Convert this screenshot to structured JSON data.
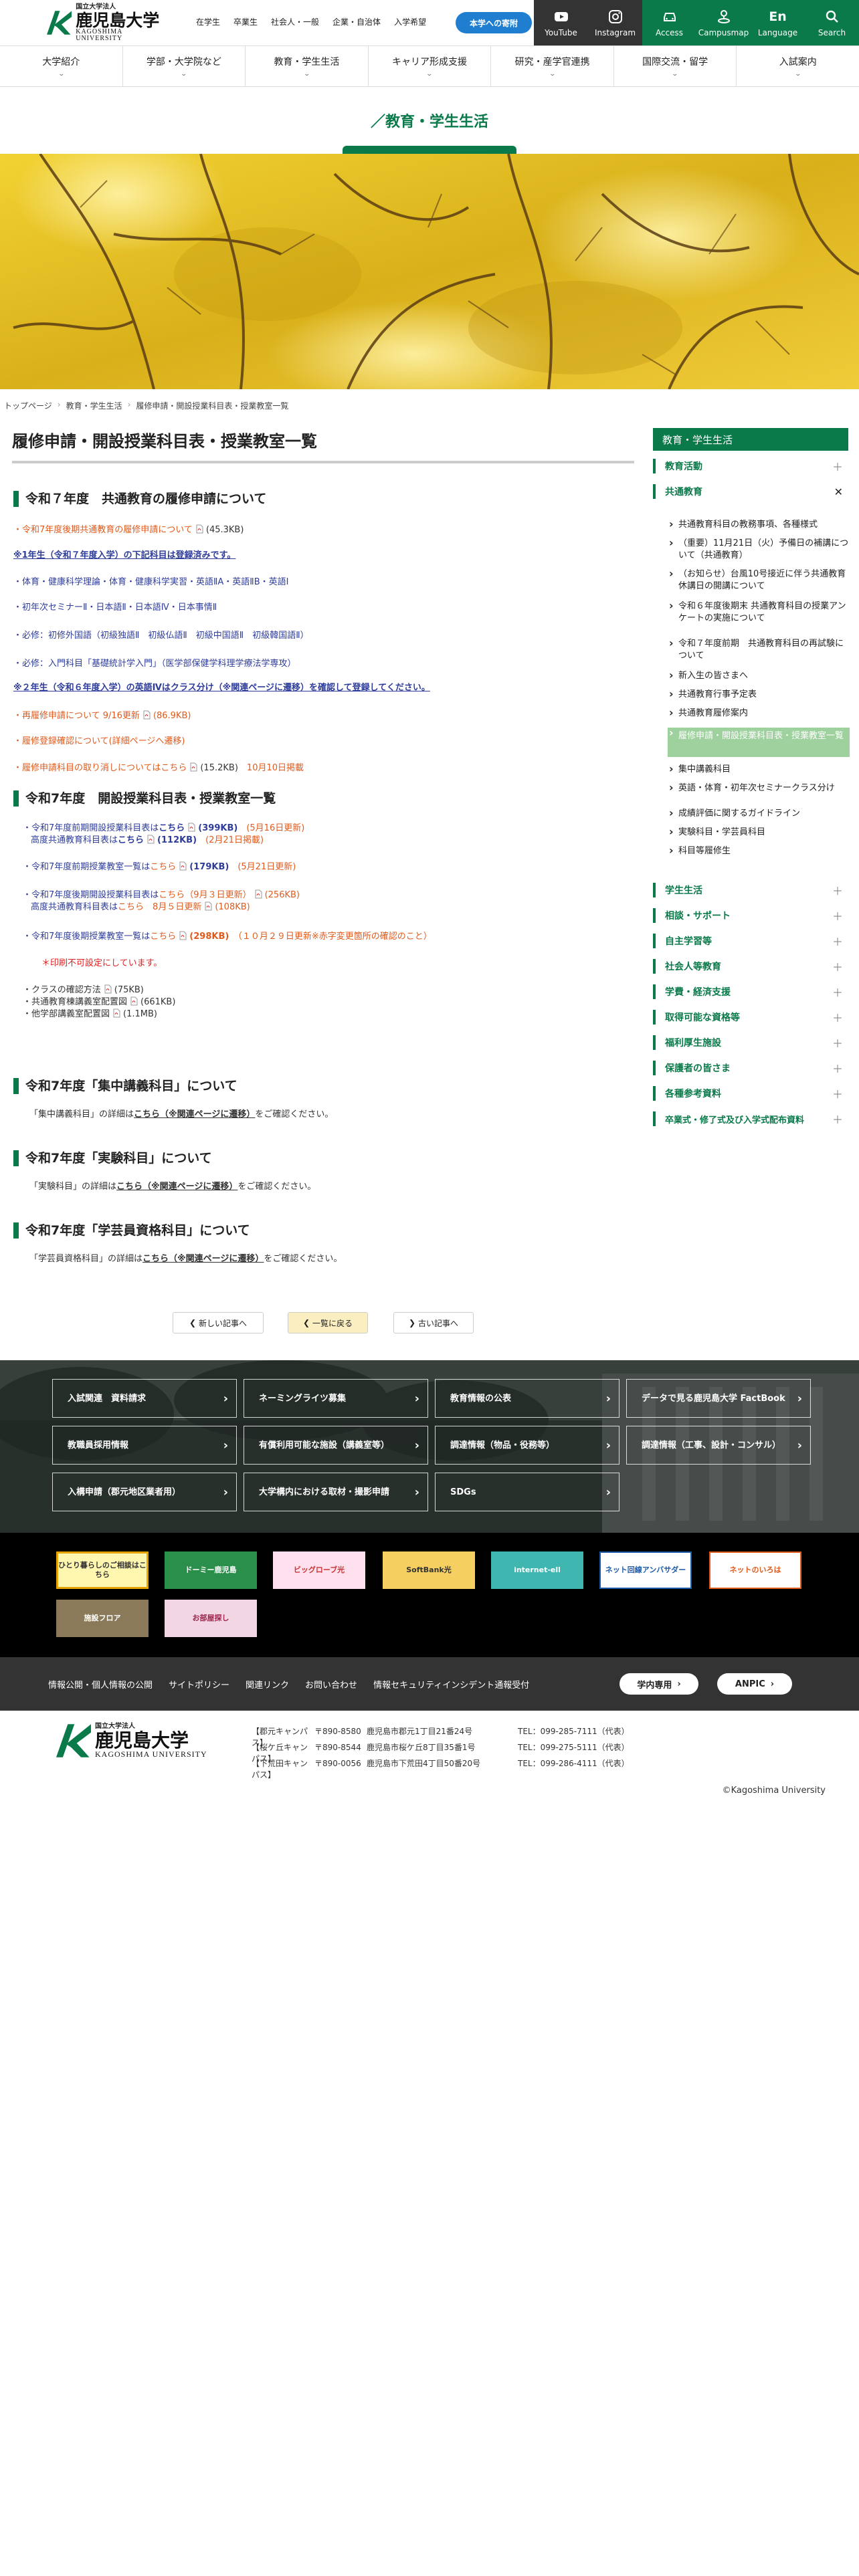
{
  "header": {
    "logo_small": "国立大学法人",
    "logo_big": "鹿児島大学",
    "logo_en": "KAGOSHIMA UNIVERSITY",
    "toplinks": [
      "在学生",
      "卒業生",
      "社会人・一般",
      "企業・自治体",
      "入学希望"
    ],
    "apply": "本学への寄附",
    "icons": [
      {
        "label": "YouTube",
        "icon": "youtube-icon"
      },
      {
        "label": "Instagram",
        "icon": "instagram-icon"
      },
      {
        "label": "Access",
        "icon": "car-icon"
      },
      {
        "label": "Campusmap",
        "icon": "map-pin-icon"
      },
      {
        "label": "Language",
        "icon": "language-icon",
        "glyph": "En"
      },
      {
        "label": "Search",
        "icon": "search-icon"
      }
    ]
  },
  "gnav": [
    "大学紹介",
    "学部・大学院など",
    "教育・学生生活",
    "キャリア形成支援",
    "研究・産学官連携",
    "国際交流・留学",
    "入試案内"
  ],
  "section_title": "／教育・学生生活",
  "breadcrumb": [
    "トップページ",
    "教育・学生生活",
    "履修申請・開設授業科目表・授業教室一覧"
  ],
  "page_title": "履修申請・開設授業科目表・授業教室一覧",
  "s1": {
    "heading": "令和７年度　共通教育の履修申請について",
    "l1": "・令和7年度後期共通教育の履修申請について",
    "l1_size": "(45.3KB)",
    "l2": "※1年生（令和７年度入学）の下記科目は登録済みです。",
    "l3": "・体育・健康科学理論・体育・健康科学実習・英語ⅡA・英語ⅡB・英語Ⅰ",
    "l4": "・初年次セミナーⅡ・日本語Ⅱ・日本語Ⅳ・日本事情Ⅱ",
    "l5": "・必修：初修外国語（初級独語Ⅱ　初級仏語Ⅱ　初級中国語Ⅱ　初級韓国語Ⅱ）",
    "l6": "・必修：入門科目「基礎統計学入門」（医学部保健学科理学療法学専攻）",
    "l7": "※２年生（令和６年度入学）の英語Ⅳはクラス分け（※関連ページに遷移）を確認して登録してください。",
    "l8": "・再履修申請について 9/16更新",
    "l8_size": "(86.9KB)",
    "l9": "・履修登録確認について(詳細ページへ遷移)",
    "l10a": "・履修申請科目の取り消しについてはこちら",
    "l10_size": "(15.2KB)",
    "l10b": "10月10日掲載"
  },
  "s2": {
    "heading": "令和7年度　開設授業科目表・授業教室一覧",
    "a1a": "・令和7年度前期開設授業科目表は",
    "a1link": "こちら",
    "a1size": "(399KB)",
    "a1date": "(5月16日更新)",
    "a2a": "高度共通教育科目表は",
    "a2link": "こちら",
    "a2size": "(112KB)",
    "a2date": "(2月21日掲載)",
    "b1a": "・令和7年度前期授業教室一覧は",
    "b1link": "こちら",
    "b1size": "(179KB)",
    "b1date": "(5月21日更新)",
    "c1a": "・令和7年度後期開設授業科目表は",
    "c1link": "こちら",
    "c1date": "（9月３日更新）",
    "c1size": "(256KB)",
    "c2a": "高度共通教育科目表は",
    "c2link": "こちら",
    "c2date": "8月５日更新",
    "c2size": "(108KB)",
    "d1a": "・令和7年度後期授業教室一覧は",
    "d1link": "こちら",
    "d1size": "(298KB)",
    "d1date": "（１０月２９日更新※赤字変更箇所の確認のこと）",
    "d2": "＊印刷不可設定にしています。",
    "e1": "・クラスの確認方法",
    "e1size": "(75KB)",
    "e2": "・共通教育棟講義室配置図",
    "e2size": "(661KB)",
    "e3": "・他学部講義室配置図",
    "e3size": "(1.1MB)"
  },
  "s3": {
    "heading": "令和7年度「集中講義科目」について",
    "pre": "「集中講義科目」の詳細は",
    "link": "こちら（※関連ページに遷移）",
    "post": "をご確認ください。"
  },
  "s4": {
    "heading": "令和7年度「実験科目」について",
    "pre": "「実験科目」の詳細は",
    "link": "こちら（※関連ページに遷移）",
    "post": "をご確認ください。"
  },
  "s5": {
    "heading": "令和7年度「学芸員資格科目」について",
    "pre": "「学芸員資格科目」の詳細は",
    "link": "こちら（※関連ページに遷移）",
    "post": "をご確認ください。"
  },
  "pager": {
    "newer": "新しい記事へ",
    "list": "一覧に戻る",
    "older": "古い記事へ"
  },
  "sidebar": {
    "head": "教育・学生生活",
    "cats": [
      "教育活動",
      "共通教育",
      "学生生活",
      "相談・サポート",
      "自主学習等",
      "社会人等教育",
      "学費・経済支援",
      "取得可能な資格等",
      "福利厚生施設",
      "保護者の皆さま",
      "各種参考資料",
      "卒業式・修了式及び入学式配布資料"
    ],
    "subs": [
      "共通教育科目の教務事項、各種様式",
      "（重要）11月21日（火）予備日の補講について（共通教育）",
      "（お知らせ）台風10号接近に伴う共通教育休講日の開講について",
      "令和６年度後期末 共通教育科目の授業アンケートの実施について",
      "令和７年度前期　共通教育科目の再試験について",
      "新入生の皆さまへ",
      "共通教育行事予定表",
      "共通教育履修案内",
      "履修申請・開設授業科目表・授業教室一覧",
      "集中講義科目",
      "英語・体育・初年次セミナークラス分け",
      "成績評価に関するガイドライン",
      "実験科目・学芸員科目",
      "科目等履修生"
    ]
  },
  "band": [
    "入試関連　資料請求",
    "ネーミングライツ募集",
    "教育情報の公表",
    "データで見る鹿児島大学 FactBook",
    "教職員採用情報",
    "有償利用可能な施設（講義室等）",
    "調達情報（物品・役務等）",
    "調達情報（工事、設計・コンサル）",
    "入構申請（郡元地区業者用）",
    "大学構内における取材・撮影申請",
    "SDGs"
  ],
  "banners": [
    "ひとり暮らしのご相談はこちら",
    "ドーミー鹿児島",
    "ビッグローブ光",
    "SoftBank光",
    "internet-ell",
    "ネット回線アンバサダー",
    "ネットのいろは",
    "施設フロア",
    "お部屋探し"
  ],
  "footnav": [
    "情報公開・個人情報の公開",
    "サイトポリシー",
    "関連リンク",
    "お問い合わせ",
    "情報セキュリティインシデント通報受付"
  ],
  "footbtns": [
    "学内専用",
    "ANPIC"
  ],
  "addresses": [
    {
      "campus": "【郡元キャンパス】",
      "zip": "〒890-8580",
      "addr": "鹿児島市郡元1丁目21番24号",
      "tel": "TEL：099-285-7111（代表）"
    },
    {
      "campus": "【桜ケ丘キャンパス】",
      "zip": "〒890-8544",
      "addr": "鹿児島市桜ケ丘8丁目35番1号",
      "tel": "TEL：099-275-5111（代表）"
    },
    {
      "campus": "【下荒田キャンパス】",
      "zip": "〒890-0056",
      "addr": "鹿児島市下荒田4丁目50番20号",
      "tel": "TEL：099-286-4111（代表）"
    }
  ],
  "copyright": "©Kagoshima University",
  "colors": {
    "brand_green": "#0a7a4a",
    "orange_link": "#e05a1c",
    "blue_link": "#2f3d9a",
    "apply_blue": "#1f7ecf"
  }
}
